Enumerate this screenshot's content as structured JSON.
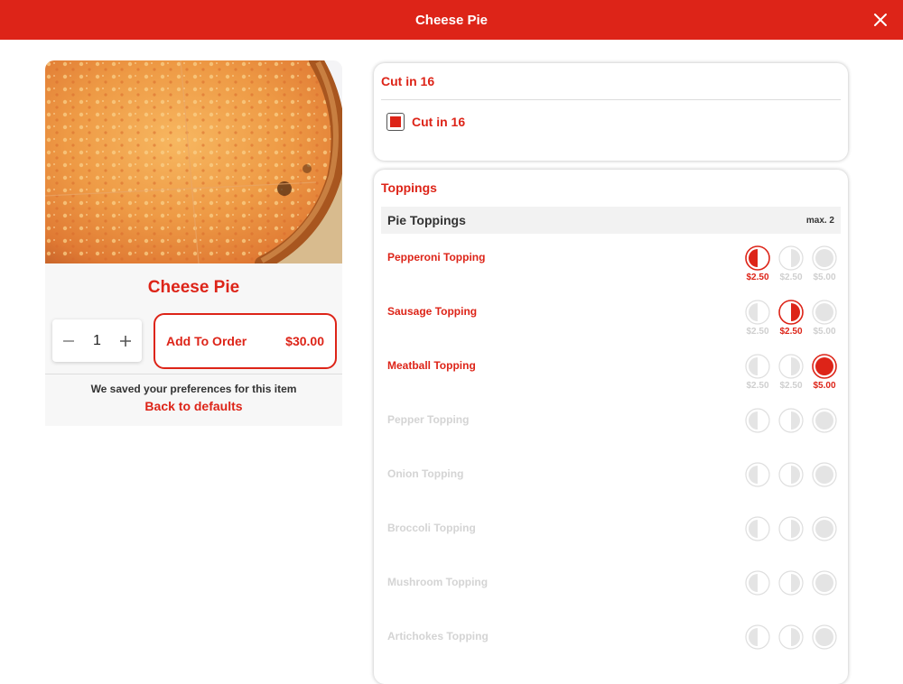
{
  "header": {
    "title": "Cheese Pie"
  },
  "item": {
    "title": "Cheese Pie",
    "quantity": "1",
    "add_label": "Add To Order",
    "price": "$30.00",
    "saved_note": "We saved your preferences for this item",
    "back_label": "Back to defaults"
  },
  "cut": {
    "title": "Cut in 16",
    "option_label": "Cut in 16",
    "checked": true
  },
  "toppings": {
    "title": "Toppings",
    "group_name": "Pie Toppings",
    "group_max": "max. 2",
    "items": [
      {
        "name": "Pepperoni Topping",
        "active": true,
        "selected": "left",
        "prices": [
          "$2.50",
          "$2.50",
          "$5.00"
        ]
      },
      {
        "name": "Sausage Topping",
        "active": true,
        "selected": "right",
        "prices": [
          "$2.50",
          "$2.50",
          "$5.00"
        ]
      },
      {
        "name": "Meatball Topping",
        "active": true,
        "selected": "whole",
        "prices": [
          "$2.50",
          "$2.50",
          "$5.00"
        ]
      },
      {
        "name": "Pepper Topping",
        "active": false,
        "selected": "none",
        "prices": []
      },
      {
        "name": "Onion Topping",
        "active": false,
        "selected": "none",
        "prices": []
      },
      {
        "name": "Broccoli Topping",
        "active": false,
        "selected": "none",
        "prices": []
      },
      {
        "name": "Mushroom Topping",
        "active": false,
        "selected": "none",
        "prices": []
      },
      {
        "name": "Artichokes Topping",
        "active": false,
        "selected": "none",
        "prices": []
      }
    ]
  },
  "colors": {
    "brand": "#dd2418",
    "muted": "#d4d4d4",
    "portion_fill": "#e4e4e4"
  },
  "icons": {
    "close": "close-icon",
    "minus": "minus-icon",
    "plus": "plus-icon"
  }
}
